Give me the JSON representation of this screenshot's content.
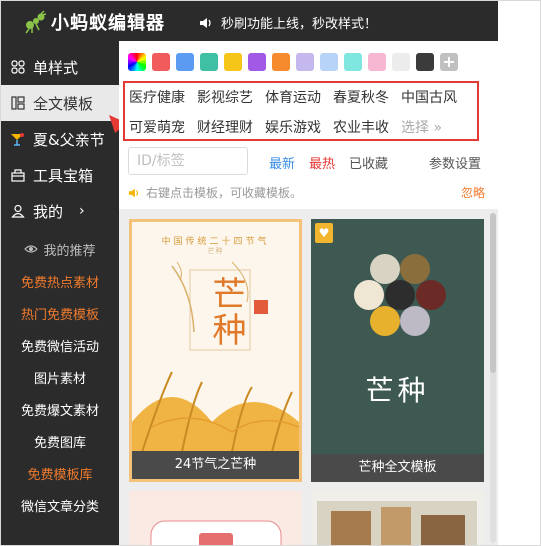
{
  "app": {
    "title": "小蚂蚁编辑器",
    "notice": "秒刷功能上线，秒改样式！"
  },
  "sidebar": {
    "items": [
      {
        "label": "单样式",
        "icon": "grid-icon"
      },
      {
        "label": "全文模板",
        "icon": "layout-icon"
      },
      {
        "label": "夏&父亲节",
        "icon": "cocktail-icon"
      },
      {
        "label": "工具宝箱",
        "icon": "toolbox-icon"
      },
      {
        "label": "我的",
        "icon": "user-icon",
        "chevron": "›"
      }
    ],
    "sub": [
      {
        "label": "我的推荐",
        "style": "gray",
        "icon": "eye-icon"
      },
      {
        "label": "免费热点素材",
        "style": "orange"
      },
      {
        "label": "热门免费模板",
        "style": "orange"
      },
      {
        "label": "免费微信活动",
        "style": "white"
      },
      {
        "label": "图片素材",
        "style": "white"
      },
      {
        "label": "免费爆文素材",
        "style": "white"
      },
      {
        "label": "免费图库",
        "style": "white"
      },
      {
        "label": "免费模板库",
        "style": "orange"
      },
      {
        "label": "微信文章分类",
        "style": "white"
      }
    ]
  },
  "palette": {
    "colors": [
      "#f15b5b",
      "#5b9bf1",
      "#3fbfa3",
      "#f5c518",
      "#a259e6",
      "#f58b2d",
      "#c5b8ee",
      "#b7d3f7",
      "#7fe6e0",
      "#f7b7d2",
      "#ececec",
      "#3b3b3b"
    ]
  },
  "categories": {
    "row1": [
      "医疗健康",
      "影视综艺",
      "体育运动",
      "春夏秋冬",
      "中国古风"
    ],
    "row2": [
      "可爱萌宠",
      "财经理财",
      "娱乐游戏",
      "农业丰收"
    ],
    "more": "选择 »"
  },
  "search": {
    "placeholder": "ID/标签"
  },
  "tabs": {
    "latest": "最新",
    "hot": "最热",
    "fav": "已收藏",
    "params": "参数设置"
  },
  "hint": {
    "text": "右键点击模板，可收藏模板。",
    "ignore": "忽略"
  },
  "cards": [
    {
      "caption": "24节气之芒种",
      "poster_title": "中国传统二十四节气",
      "poster_sub": "芒种",
      "big": "芒种"
    },
    {
      "caption": "芒种全文模板",
      "title": "芒种"
    }
  ]
}
